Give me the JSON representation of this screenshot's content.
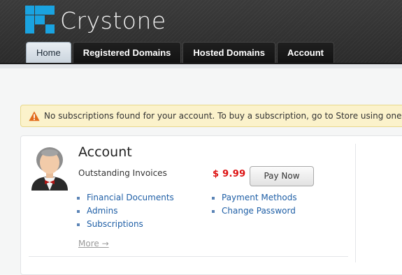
{
  "header": {
    "brand": "Crystone",
    "tabs": [
      {
        "label": "Home",
        "active": true
      },
      {
        "label": "Registered Domains",
        "active": false
      },
      {
        "label": "Hosted Domains",
        "active": false
      },
      {
        "label": "Account",
        "active": false
      }
    ],
    "logo_color": "#1aa3e0"
  },
  "notice": {
    "text": "No subscriptions found for your account. To buy a subscription, go to Store using one of the links above.",
    "icon": "warning-icon",
    "icon_color": "#e26b1b"
  },
  "account": {
    "title": "Account",
    "outstanding_label": "Outstanding Invoices",
    "outstanding_amount": "$ 9.99",
    "pay_button": "Pay Now",
    "links_left": [
      "Financial Documents",
      "Admins",
      "Subscriptions"
    ],
    "links_right": [
      "Payment Methods",
      "Change Password"
    ],
    "more": "More →",
    "amount_color": "#dd1111",
    "link_color": "#1f5fa6"
  }
}
